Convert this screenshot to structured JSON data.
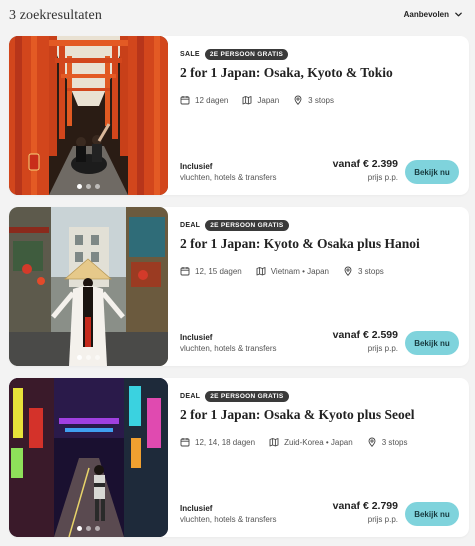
{
  "header": {
    "results_count": "3 zoekresultaten",
    "sort_label": "Aanbevolen"
  },
  "cards": [
    {
      "badge_plain": "SALE",
      "badge_pill": "2E PERSOON GRATIS",
      "title": "2 for 1 Japan: Osaka, Kyoto & Tokio",
      "duration": "12 dagen",
      "countries": "Japan",
      "stops": "3 stops",
      "included_heading": "Inclusief",
      "included_text": "vluchten, hotels & transfers",
      "price": "vanaf € 2.399",
      "price_unit": "prijs p.p.",
      "button": "Bekijk nu",
      "image": "torii-gates-photo"
    },
    {
      "badge_plain": "DEAL",
      "badge_pill": "2E PERSOON GRATIS",
      "title": "2 for 1 Japan: Kyoto & Osaka plus Hanoi",
      "duration": "12, 15 dagen",
      "countries": "Vietnam • Japan",
      "stops": "3 stops",
      "included_heading": "Inclusief",
      "included_text": "vluchten, hotels & transfers",
      "price": "vanaf € 2.599",
      "price_unit": "prijs p.p.",
      "button": "Bekijk nu",
      "image": "hanoi-street-photo"
    },
    {
      "badge_plain": "DEAL",
      "badge_pill": "2E PERSOON GRATIS",
      "title": "2 for 1 Japan: Osaka & Kyoto plus Seoel",
      "duration": "12, 14, 18 dagen",
      "countries": "Zuid-Korea • Japan",
      "stops": "3 stops",
      "included_heading": "Inclusief",
      "included_text": "vluchten, hotels & transfers",
      "price": "vanaf € 2.799",
      "price_unit": "prijs p.p.",
      "button": "Bekijk nu",
      "image": "seoul-neon-street-photo"
    }
  ],
  "colors": {
    "background": "#f3f3f3",
    "button": "#7fd3dc",
    "badge_pill": "#3a3a3a"
  }
}
